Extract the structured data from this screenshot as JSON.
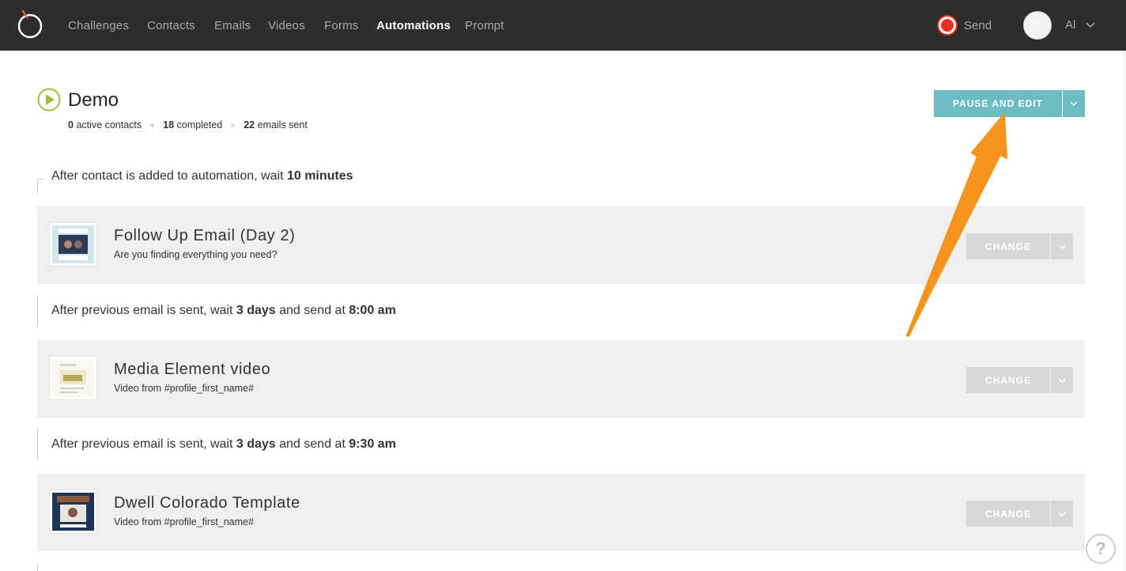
{
  "nav": {
    "items": [
      {
        "label": "Challenges",
        "active": false
      },
      {
        "label": "Contacts",
        "active": false
      },
      {
        "label": "Emails",
        "active": false
      },
      {
        "label": "Videos",
        "active": false
      },
      {
        "label": "Forms",
        "active": false
      },
      {
        "label": "Automations",
        "active": true
      },
      {
        "label": "Prompt",
        "active": false
      }
    ],
    "send_label": "Send",
    "user_name": "Al"
  },
  "automation": {
    "title": "Demo",
    "stats": {
      "active_count": "0",
      "active_label": "active contacts",
      "completed_count": "18",
      "completed_label": "completed",
      "emails_count": "22",
      "emails_label": "emails sent"
    },
    "pause_label": "PAUSE AND EDIT"
  },
  "steps": [
    {
      "wait": {
        "prefix": "After contact is added to automation, wait ",
        "duration": "10 minutes",
        "middle": "",
        "time": ""
      },
      "email": {
        "title": "Follow Up Email (Day 2)",
        "subtitle": "Are you finding everything you need?",
        "change_label": "CHANGE"
      }
    },
    {
      "wait": {
        "prefix": "After previous email is sent, wait ",
        "duration": "3 days",
        "middle": " and send at ",
        "time": "8:00 am"
      },
      "email": {
        "title": "Media Element video",
        "subtitle": "Video from #profile_first_name#",
        "change_label": "CHANGE"
      }
    },
    {
      "wait": {
        "prefix": "After previous email is sent, wait ",
        "duration": "3 days",
        "middle": " and send at ",
        "time": "9:30 am"
      },
      "email": {
        "title": "Dwell Colorado Template",
        "subtitle": "Video from #profile_first_name#",
        "change_label": "CHANGE"
      }
    }
  ],
  "help_label": "?",
  "colors": {
    "nav_bg": "#2d2d2d",
    "accent": "#6cbdc3",
    "play_green": "#9bbf3b",
    "send_red": "#e8321f",
    "annotation_arrow": "#f7941d",
    "card_bg": "#efefef",
    "change_btn": "#d7d7d7"
  }
}
